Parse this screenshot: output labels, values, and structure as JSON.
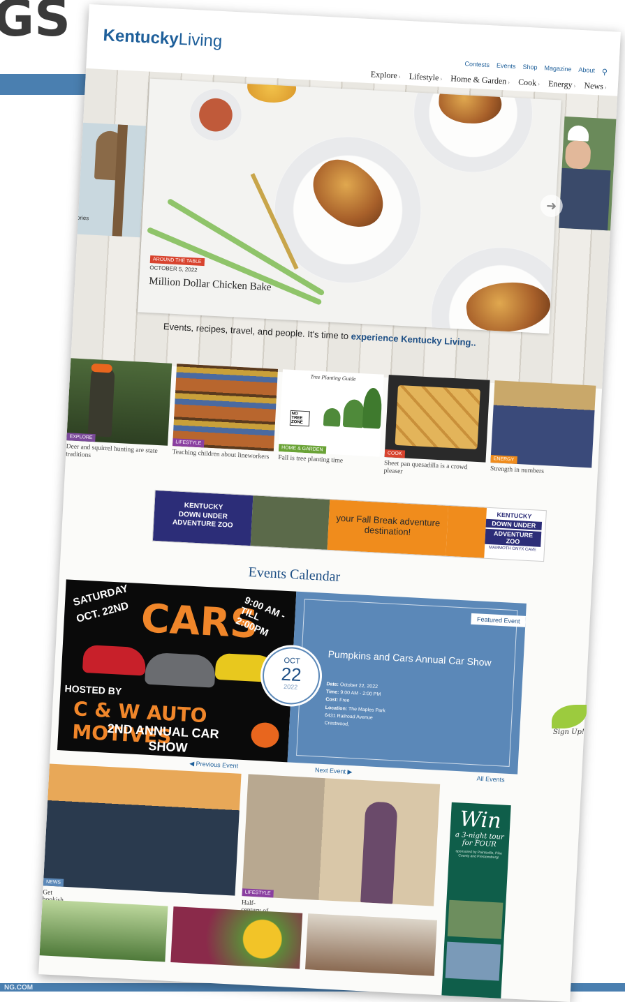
{
  "slide": {
    "heading_fragment": "GS",
    "footer_fragment": "NG.COM"
  },
  "site": {
    "logo_bold": "Kentucky",
    "logo_light": "Living"
  },
  "utility_nav": [
    "Contests",
    "Events",
    "Shop",
    "Magazine",
    "About"
  ],
  "main_nav": [
    "Explore",
    "Lifestyle",
    "Home & Garden",
    "Cook",
    "Energy",
    "News"
  ],
  "hero": {
    "tag": "AROUND THE TABLE",
    "date": "OCTOBER 5, 2022",
    "title": "Million Dollar Chicken Bake",
    "left_caption": "ories"
  },
  "tagline": {
    "pre": "Events, recipes, travel, and people. It's time to ",
    "bold": "experience Kentucky Living.."
  },
  "featured": [
    {
      "tag": "EXPLORE",
      "tag_color": "#7b4a9a",
      "caption": "Deer and squirrel hunting are state traditions"
    },
    {
      "tag": "LIFESTYLE",
      "tag_color": "#8a3fa0",
      "caption": "Teaching children about lineworkers"
    },
    {
      "tag": "HOME & GARDEN",
      "tag_color": "#6aa336",
      "caption": "Fall is tree planting time",
      "chart_title": "Tree Planting Guide",
      "chart_zone": "NO TREE ZONE"
    },
    {
      "tag": "COOK",
      "tag_color": "#d8432e",
      "caption": "Sheet pan quesadilla is a crowd pleaser"
    },
    {
      "tag": "ENERGY",
      "tag_color": "#f08c1c",
      "caption": "Strength in numbers"
    }
  ],
  "ad": {
    "left_lines": [
      "KENTUCKY",
      "DOWN UNDER",
      "ADVENTURE ZOO"
    ],
    "middle": "your Fall Break adventure destination!",
    "right_title": "KENTUCKY",
    "right_sub1": "DOWN UNDER",
    "right_sub2": "ADVENTURE ZOO",
    "right_foot": "MAMMOTH ONYX CAVE"
  },
  "events": {
    "heading": "Events Calendar",
    "badge": "Featured Event",
    "poster": {
      "l1": "SATURDAY",
      "l2": "OCT. 22ND",
      "l3": "CARS",
      "l4": "9:00 AM - TILL 2:00PM",
      "l5": "HOSTED BY",
      "l6": "C & W AUTO MOTIVES",
      "l7": "2ND ANNUAL CAR",
      "l8": "SHOW"
    },
    "month": "OCT",
    "day": "22",
    "year": "2022",
    "name": "Pumpkins and Cars Annual Car Show",
    "date_label": "Date:",
    "date": "October 22, 2022",
    "time_label": "Time:",
    "time": "9:00 AM - 2:00 PM",
    "cost_label": "Cost:",
    "cost": "Free",
    "location_label": "Location:",
    "location_1": "The Maples Park",
    "location_2": "6431 Railroad Avenue",
    "location_3": "Crestwood,",
    "prev": "Previous Event",
    "next": "Next Event",
    "all": "All Events"
  },
  "stories": [
    {
      "tag": "NEWS",
      "tag_color": "#5b88b8",
      "caption": "Get bookish in the Bluegrass"
    },
    {
      "tag": "LIFESTYLE",
      "tag_color": "#8a3fa0",
      "caption": "Half-century of telling Kentucky's story"
    }
  ],
  "win_ad": {
    "big": "Win",
    "line1": "a 3-night tour",
    "line2": "for FOUR",
    "sponsor": "sponsored by Paintsville, Pike County and Prestonsburg!"
  },
  "signup": "Sign Up!"
}
